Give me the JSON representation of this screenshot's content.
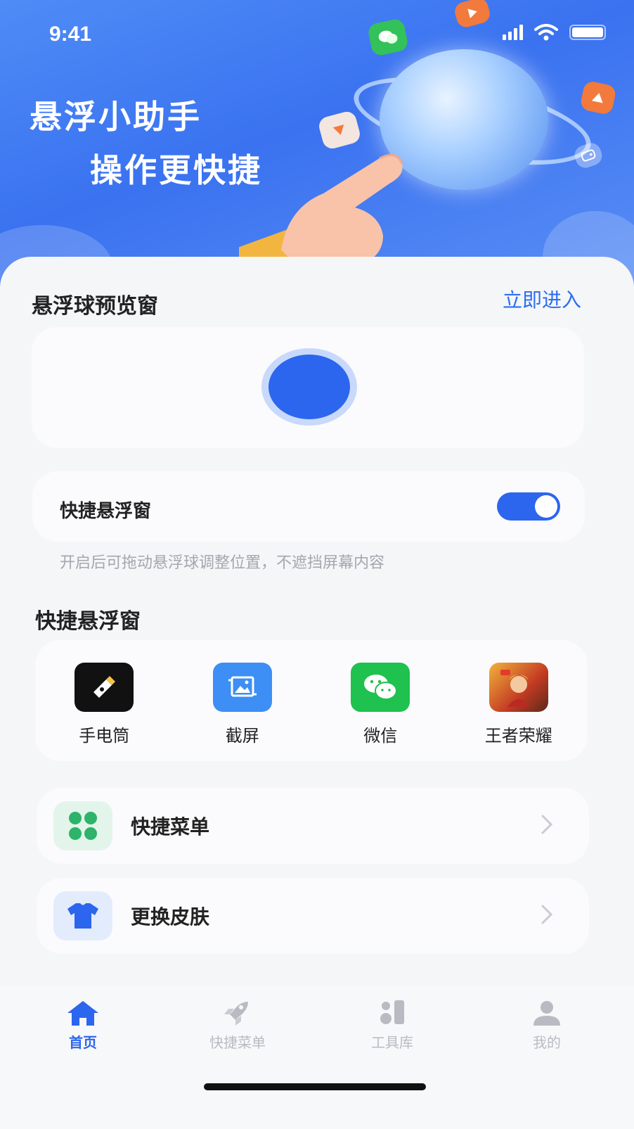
{
  "status_bar": {
    "time": "9:41"
  },
  "hero": {
    "line1": "悬浮小助手",
    "line2": "操作更快捷"
  },
  "preview": {
    "title": "悬浮球预览窗",
    "enter_link": "立即进入"
  },
  "quick_float": {
    "toggle_label": "快捷悬浮窗",
    "toggle_on": true,
    "hint": "开启后可拖动悬浮球调整位置，不遮挡屏幕内容"
  },
  "shortcuts": {
    "title": "快捷悬浮窗",
    "apps": [
      {
        "label": "手电筒",
        "icon": "flashlight-icon"
      },
      {
        "label": "截屏",
        "icon": "screenshot-icon"
      },
      {
        "label": "微信",
        "icon": "wechat-icon"
      },
      {
        "label": "王者荣耀",
        "icon": "game-icon"
      }
    ]
  },
  "menu": [
    {
      "label": "快捷菜单",
      "icon": "four-leaf-grid-icon"
    },
    {
      "label": "更换皮肤",
      "icon": "tshirt-icon"
    }
  ],
  "tabs": [
    {
      "label": "首页",
      "icon": "home-icon",
      "active": true
    },
    {
      "label": "快捷菜单",
      "icon": "rocket-icon",
      "active": false
    },
    {
      "label": "工具库",
      "icon": "tools-icon",
      "active": false
    },
    {
      "label": "我的",
      "icon": "user-icon",
      "active": false
    }
  ],
  "colors": {
    "accent": "#2c66ee",
    "hero_blue": "#3a72f0",
    "panel_bg": "#f5f6f8"
  }
}
